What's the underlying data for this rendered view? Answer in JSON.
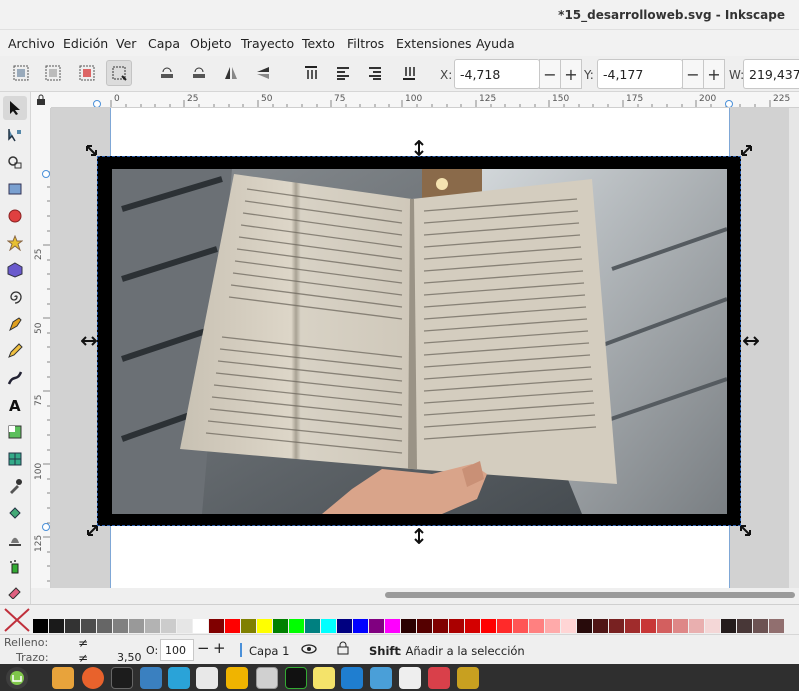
{
  "window": {
    "title": "*15_desarrolloweb.svg - Inkscape"
  },
  "menu": [
    "Archivo",
    "Edición",
    "Ver",
    "Capa",
    "Objeto",
    "Trayecto",
    "Texto",
    "Filtros",
    "Extensiones",
    "Ayuda"
  ],
  "toolbar": {
    "x_label": "X:",
    "x_value": "-4,718",
    "y_label": "Y:",
    "y_value": "-4,177",
    "w_label": "W:",
    "w_value": "219,437",
    "minus": "−",
    "plus": "+"
  },
  "ruler": {
    "h_ticks": [
      "0",
      "25",
      "50",
      "75",
      "100",
      "125",
      "150",
      "175",
      "200",
      "225"
    ],
    "v_ticks": [
      "25",
      "50",
      "75",
      "100",
      "125"
    ]
  },
  "palette": {
    "colors": [
      "#000000",
      "#1a1a1a",
      "#333333",
      "#4d4d4d",
      "#666666",
      "#808080",
      "#999999",
      "#b3b3b3",
      "#cccccc",
      "#e6e6e6",
      "#ffffff",
      "#800000",
      "#ff0000",
      "#808000",
      "#ffff00",
      "#008000",
      "#00ff00",
      "#008080",
      "#00ffff",
      "#000080",
      "#0000ff",
      "#800080",
      "#ff00ff",
      "#2b0000",
      "#550000",
      "#800000",
      "#aa0000",
      "#d40000",
      "#ff0000",
      "#ff2a2a",
      "#ff5555",
      "#ff8080",
      "#ffaaaa",
      "#ffd5d5",
      "#280b0b",
      "#501616",
      "#782121",
      "#a02c2c",
      "#c83737",
      "#d35f5f",
      "#de8787",
      "#e9afaf",
      "#f4d7d7",
      "#241c1c",
      "#483737",
      "#6c5353",
      "#916f6f"
    ]
  },
  "status": {
    "fill_label": "Relleno:",
    "stroke_label": "Trazo:",
    "fill_value": "≠",
    "stroke_value": "≠",
    "stroke_width": "3,50",
    "opacity_label": "O:",
    "opacity_value": "100",
    "layer": "Capa 1",
    "hint_key": "Shift",
    "hint_text": ": Añadir a la selección"
  },
  "colors": {
    "accent": "#4a90d9",
    "taskbar": "#2f2f2f",
    "selection_black": "#000000"
  }
}
